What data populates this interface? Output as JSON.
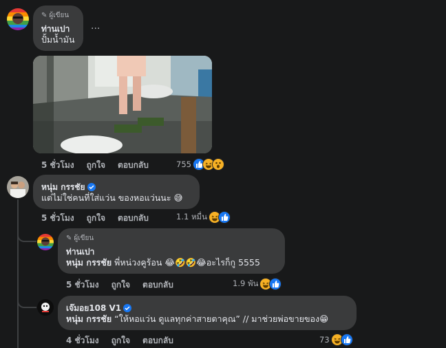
{
  "colors": {
    "background": "#18191a",
    "bubble": "#3a3b3c",
    "text": "#e4e6eb",
    "muted": "#b0b3b8",
    "like": "#1877f2",
    "haha": "#f7b125"
  },
  "comments": [
    {
      "author_tag": "ผู้เขียน",
      "name": "ท่านเปา",
      "text": "ปั้มน้ำมัน",
      "more": "...",
      "time": "5 ชั่วโมง",
      "like": "ถูกใจ",
      "reply": "ตอบกลับ",
      "reaction_count": "755",
      "reactions": [
        "like-icon",
        "haha-icon",
        "wow-icon"
      ]
    },
    {
      "name": "หนุ่ม กรรชัย",
      "verified": true,
      "text": "แต่ไม่ใช่คนที่ใส่แว่น ของหอแว่นนะ 😅",
      "time": "5 ชั่วโมง",
      "like": "ถูกใจ",
      "reply": "ตอบกลับ",
      "reaction_count": "1.1 หมื่น",
      "reactions": [
        "haha-icon",
        "like-icon"
      ]
    },
    {
      "author_tag": "ผู้เขียน",
      "name": "ท่านเปา",
      "mention": "หนุ่ม กรรชัย",
      "text": "พี่หน่วงคูร้อน 😂🤣🤣😂อะไรก็กู 5555",
      "time": "5 ชั่วโมง",
      "like": "ถูกใจ",
      "reply": "ตอบกลับ",
      "reaction_count": "1.9 พัน",
      "reactions": [
        "haha-icon",
        "like-icon"
      ]
    },
    {
      "name": "เจ๊มอย108 V1",
      "verified": true,
      "mention": "หนุ่ม กรรชัย",
      "text": "“ให้หอแว่น ดูแลทุกค่าสายตาคุณ” // มาช่วยพ่อขายของ😁",
      "time": "4 ชั่วโมง",
      "like": "ถูกใจ",
      "reply": "ตอบกลับ",
      "reaction_count": "73",
      "reactions": [
        "haha-icon",
        "like-icon"
      ]
    }
  ]
}
